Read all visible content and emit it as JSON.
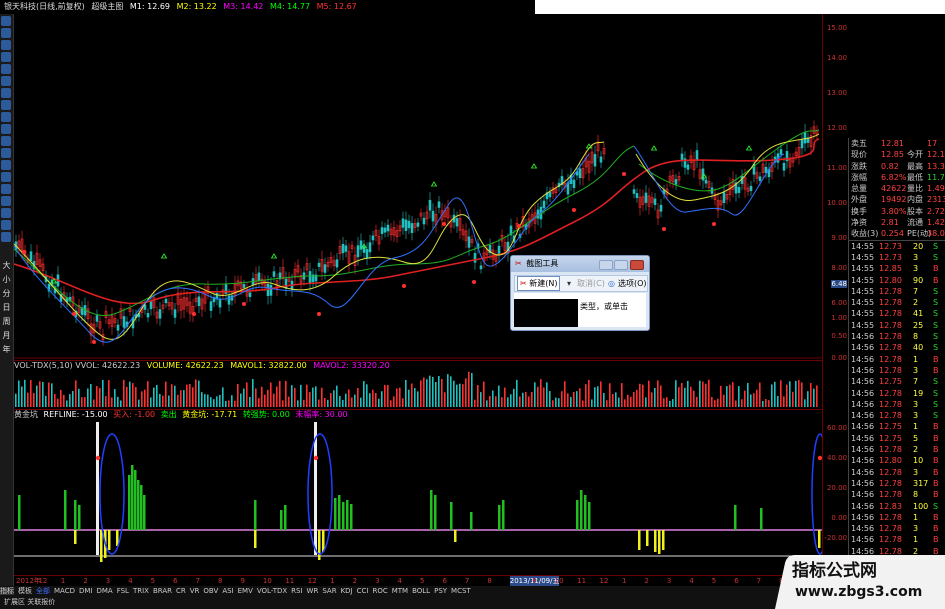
{
  "topbar": {
    "title": "银天科技(日线,前复权)",
    "tab": "超级主图",
    "ma": [
      {
        "label": "M1: 12.69",
        "color": "#ffffff"
      },
      {
        "label": "M2: 13.22",
        "color": "#ffff00"
      },
      {
        "label": "M3: 14.42",
        "color": "#ff00ff"
      },
      {
        "label": "M4: 14.77",
        "color": "#00ff00"
      },
      {
        "label": "M5: 12.67",
        "color": "#ff3030"
      }
    ]
  },
  "toolbar_side": [
    "大",
    "小",
    "分",
    "日",
    "周",
    "月",
    "年"
  ],
  "volume_panel": {
    "label": "VOL-TDX(5,10) VVOL: 42622.23",
    "volume": "VOLUME: 42622.23",
    "mavol1": "MAVOL1: 32822.00",
    "mavol2": "MAVOL2: 33320.20"
  },
  "indicator_panel": {
    "name": "黄金坑",
    "items": [
      {
        "label": "REFLINE: -15.00",
        "color": "#ffffff"
      },
      {
        "label": "买入: -1.00",
        "color": "#ff3030"
      },
      {
        "label": "卖出",
        "color": "#00ff00"
      },
      {
        "label": "黄金坑: -17.71",
        "color": "#ffff00"
      },
      {
        "label": "转强势: 0.00",
        "color": "#00ff00"
      },
      {
        "label": "未幅率: 30.00",
        "color": "#ff00ff"
      }
    ]
  },
  "axis_labels": [
    "15.00",
    "14.00",
    "13.00",
    "12.00",
    "11.00",
    "10.00",
    "9.00",
    "8.00",
    "6.48",
    "6.00",
    "1.00",
    "0.50",
    "0.00",
    "60.00",
    "40.00",
    "20.00",
    "0.00",
    "-20.00",
    "-40.00"
  ],
  "quote": {
    "rows": [
      {
        "k1": "卖五",
        "v1": "12.81",
        "k2": "",
        "v2": "17"
      },
      {
        "k1": "现价",
        "v1": "12.85",
        "k2": "今开",
        "v2": "12.11"
      },
      {
        "k1": "涨跌",
        "v1": "0.82",
        "k2": "最高",
        "v2": "13.33"
      },
      {
        "k1": "涨幅",
        "v1": "6.82%",
        "k2": "最低",
        "v2": "11.77"
      },
      {
        "k1": "总量",
        "v1": "42622",
        "k2": "量比",
        "v2": "1.49"
      },
      {
        "k1": "外盘",
        "v1": "19492",
        "k2": "内盘",
        "v2": "23130"
      },
      {
        "k1": "换手",
        "v1": "3.80%",
        "k2": "股本",
        "v2": "2.72亿"
      },
      {
        "k1": "净资",
        "v1": "2.81",
        "k2": "流通",
        "v2": "1.42亿"
      },
      {
        "k1": "收益(3)",
        "v1": "0.254",
        "k2": "PE(动)",
        "v2": "38.0"
      }
    ],
    "ticks": [
      {
        "t": "14:55",
        "p": "12.73",
        "v": "20",
        "d": "S"
      },
      {
        "t": "14:55",
        "p": "12.73",
        "v": "3",
        "d": "S"
      },
      {
        "t": "14:55",
        "p": "12.85",
        "v": "3",
        "d": "B"
      },
      {
        "t": "14:55",
        "p": "12.80",
        "v": "90",
        "d": "B"
      },
      {
        "t": "14:55",
        "p": "12.78",
        "v": "7",
        "d": "S"
      },
      {
        "t": "14:55",
        "p": "12.78",
        "v": "2",
        "d": "S"
      },
      {
        "t": "14:55",
        "p": "12.78",
        "v": "41",
        "d": "S"
      },
      {
        "t": "14:55",
        "p": "12.78",
        "v": "25",
        "d": "S"
      },
      {
        "t": "14:56",
        "p": "12.78",
        "v": "8",
        "d": "S"
      },
      {
        "t": "14:56",
        "p": "12.78",
        "v": "40",
        "d": "S"
      },
      {
        "t": "14:56",
        "p": "12.78",
        "v": "1",
        "d": "B"
      },
      {
        "t": "14:56",
        "p": "12.78",
        "v": "3",
        "d": "B"
      },
      {
        "t": "14:56",
        "p": "12.75",
        "v": "7",
        "d": "S"
      },
      {
        "t": "14:56",
        "p": "12.78",
        "v": "19",
        "d": "S"
      },
      {
        "t": "14:56",
        "p": "12.78",
        "v": "3",
        "d": "S"
      },
      {
        "t": "14:56",
        "p": "12.78",
        "v": "3",
        "d": "S"
      },
      {
        "t": "14:56",
        "p": "12.75",
        "v": "1",
        "d": "B"
      },
      {
        "t": "14:56",
        "p": "12.75",
        "v": "5",
        "d": "B"
      },
      {
        "t": "14:56",
        "p": "12.78",
        "v": "2",
        "d": "B"
      },
      {
        "t": "14:56",
        "p": "12.80",
        "v": "10",
        "d": "B"
      },
      {
        "t": "14:56",
        "p": "12.78",
        "v": "3",
        "d": "B"
      },
      {
        "t": "14:56",
        "p": "12.78",
        "v": "317",
        "d": "B"
      },
      {
        "t": "14:56",
        "p": "12.78",
        "v": "8",
        "d": "B"
      },
      {
        "t": "14:56",
        "p": "12.83",
        "v": "100",
        "d": "S"
      },
      {
        "t": "14:56",
        "p": "12.78",
        "v": "1",
        "d": "B"
      },
      {
        "t": "14:56",
        "p": "12.78",
        "v": "3",
        "d": "B"
      },
      {
        "t": "14:56",
        "p": "12.78",
        "v": "1",
        "d": "B"
      },
      {
        "t": "14:56",
        "p": "12.78",
        "v": "2",
        "d": "B"
      }
    ]
  },
  "dates": [
    "2012年",
    "12",
    "1",
    "2",
    "3",
    "4",
    "5",
    "6",
    "7",
    "8",
    "9",
    "10",
    "11",
    "12",
    "1",
    "2",
    "3",
    "4",
    "5",
    "6",
    "7",
    "8",
    "2013/11/09/五",
    "9",
    "10",
    "11",
    "12",
    "1",
    "2",
    "3",
    "4",
    "5",
    "6",
    "7",
    "8",
    "9"
  ],
  "tabs": [
    "指标",
    "模板",
    "全部",
    "MACD",
    "DMI",
    "DMA",
    "FSL",
    "TRIX",
    "BRAR",
    "CR",
    "VR",
    "OBV",
    "ASI",
    "EMV",
    "VOL-TDX",
    "RSI",
    "WR",
    "SAR",
    "KDJ",
    "CCI",
    "ROC",
    "MTM",
    "BOLL",
    "PSY",
    "MCST"
  ],
  "tabs2": "扩展区  关联报价",
  "dialog": {
    "title": "截图工具",
    "new_label": "新建(N)",
    "cancel_label": "取消(C)",
    "options_label": "选项(O)",
    "hint": "类型，或单击"
  },
  "watermark": {
    "title": "指标公式网",
    "url": "www.zbgs3.com"
  }
}
